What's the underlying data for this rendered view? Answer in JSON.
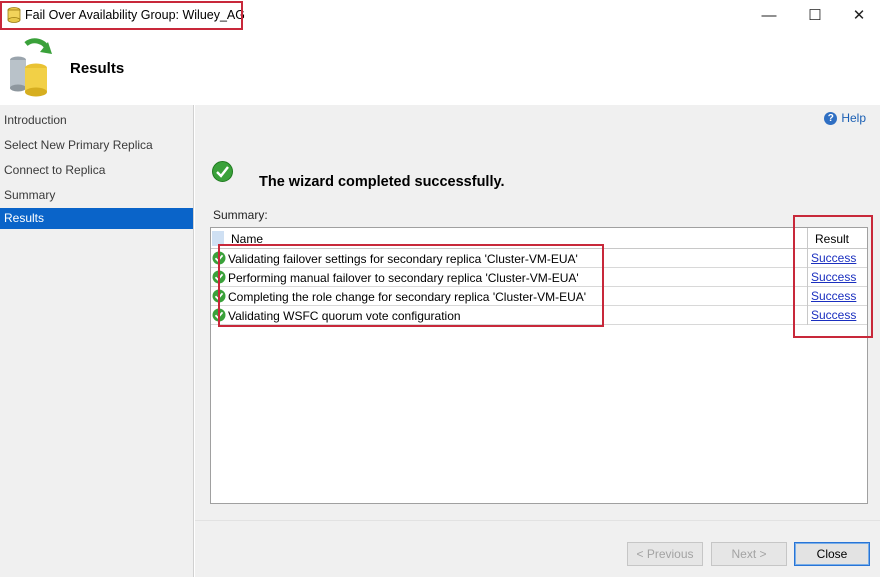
{
  "window": {
    "title": "Fail Over Availability Group: Wiluey_AG",
    "minimize_glyph": "—",
    "maximize_glyph": "☐",
    "close_glyph": "✕"
  },
  "header": {
    "title": "Results",
    "icon": "database-refresh-icon"
  },
  "nav": {
    "items": [
      {
        "label": "Introduction",
        "active": false
      },
      {
        "label": "Select New Primary Replica",
        "active": false
      },
      {
        "label": "Connect to Replica",
        "active": false
      },
      {
        "label": "Summary",
        "active": false
      },
      {
        "label": "Results",
        "active": true
      }
    ]
  },
  "main": {
    "help_label": "Help",
    "headline": "The wizard completed successfully.",
    "summary_label": "Summary:",
    "table": {
      "columns": [
        "Name",
        "Result"
      ],
      "rows": [
        {
          "name": "Validating failover settings for secondary replica 'Cluster-VM-EUA'",
          "result": "Success"
        },
        {
          "name": "Performing manual failover to secondary replica 'Cluster-VM-EUA'",
          "result": "Success"
        },
        {
          "name": "Completing the role change for secondary replica 'Cluster-VM-EUA'",
          "result": "Success"
        },
        {
          "name": "Validating WSFC quorum vote configuration",
          "result": "Success"
        }
      ]
    }
  },
  "footer": {
    "previous_label": "< Previous",
    "next_label": "Next >",
    "close_label": "Close"
  },
  "colors": {
    "accent": "#0a64c9",
    "annotation": "#c8283a",
    "success": "#3aa13a"
  }
}
